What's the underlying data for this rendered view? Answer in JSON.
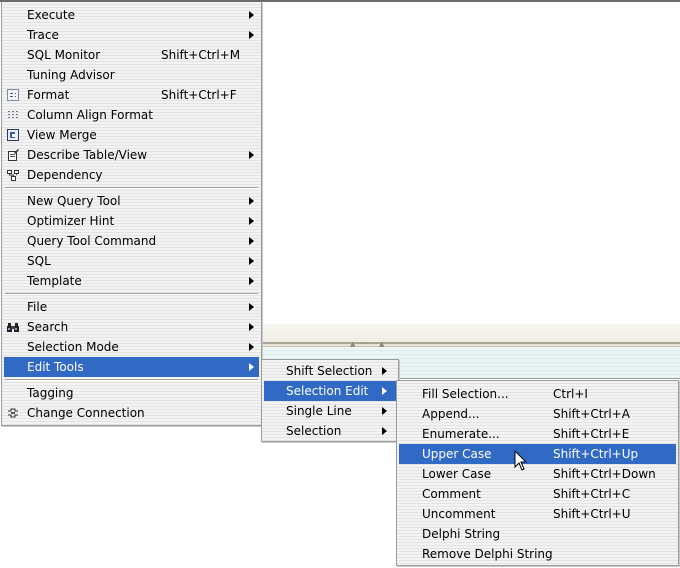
{
  "main_menu": {
    "items": [
      {
        "label": "Execute",
        "submenu": true
      },
      {
        "label": "Trace",
        "submenu": true
      },
      {
        "label": "SQL Monitor",
        "shortcut": "Shift+Ctrl+M"
      },
      {
        "label": "Tuning Advisor"
      },
      {
        "label": "Format",
        "shortcut": "Shift+Ctrl+F",
        "icon": "format-icon"
      },
      {
        "label": "Column Align Format",
        "icon": "column-align-icon"
      },
      {
        "label": "View Merge",
        "icon": "view-merge-icon"
      },
      {
        "label": "Describe Table/View",
        "submenu": true,
        "icon": "describe-table-icon"
      },
      {
        "label": "Dependency",
        "icon": "dependency-icon"
      },
      {
        "label": "New Query Tool",
        "submenu": true
      },
      {
        "label": "Optimizer Hint",
        "submenu": true
      },
      {
        "label": "Query Tool Command",
        "submenu": true
      },
      {
        "label": "SQL",
        "submenu": true
      },
      {
        "label": "Template",
        "submenu": true
      },
      {
        "label": "File",
        "submenu": true
      },
      {
        "label": "Search",
        "submenu": true,
        "icon": "binoculars-icon"
      },
      {
        "label": "Selection Mode",
        "submenu": true
      },
      {
        "label": "Edit Tools",
        "submenu": true,
        "highlighted": true
      },
      {
        "label": "Tagging"
      },
      {
        "label": "Change Connection",
        "icon": "change-connection-icon"
      }
    ]
  },
  "edit_tools_menu": {
    "items": [
      {
        "label": "Shift Selection",
        "submenu": true
      },
      {
        "label": "Selection Edit",
        "submenu": true,
        "highlighted": true
      },
      {
        "label": "Single Line",
        "submenu": true
      },
      {
        "label": "Selection",
        "submenu": true
      }
    ]
  },
  "selection_edit_menu": {
    "items": [
      {
        "label": "Fill Selection...",
        "shortcut": "Ctrl+I"
      },
      {
        "label": "Append...",
        "shortcut": "Shift+Ctrl+A"
      },
      {
        "label": "Enumerate...",
        "shortcut": "Shift+Ctrl+E"
      },
      {
        "label": "Upper Case",
        "shortcut": "Shift+Ctrl+Up",
        "highlighted": true
      },
      {
        "label": "Lower Case",
        "shortcut": "Shift+Ctrl+Down"
      },
      {
        "label": "Comment",
        "shortcut": "Shift+Ctrl+C"
      },
      {
        "label": "Uncomment",
        "shortcut": "Shift+Ctrl+U"
      },
      {
        "label": "Delphi String"
      },
      {
        "label": "Remove Delphi String"
      }
    ]
  },
  "colors": {
    "highlight": "#316ac5",
    "menu_bg": "#f3f3f3"
  }
}
